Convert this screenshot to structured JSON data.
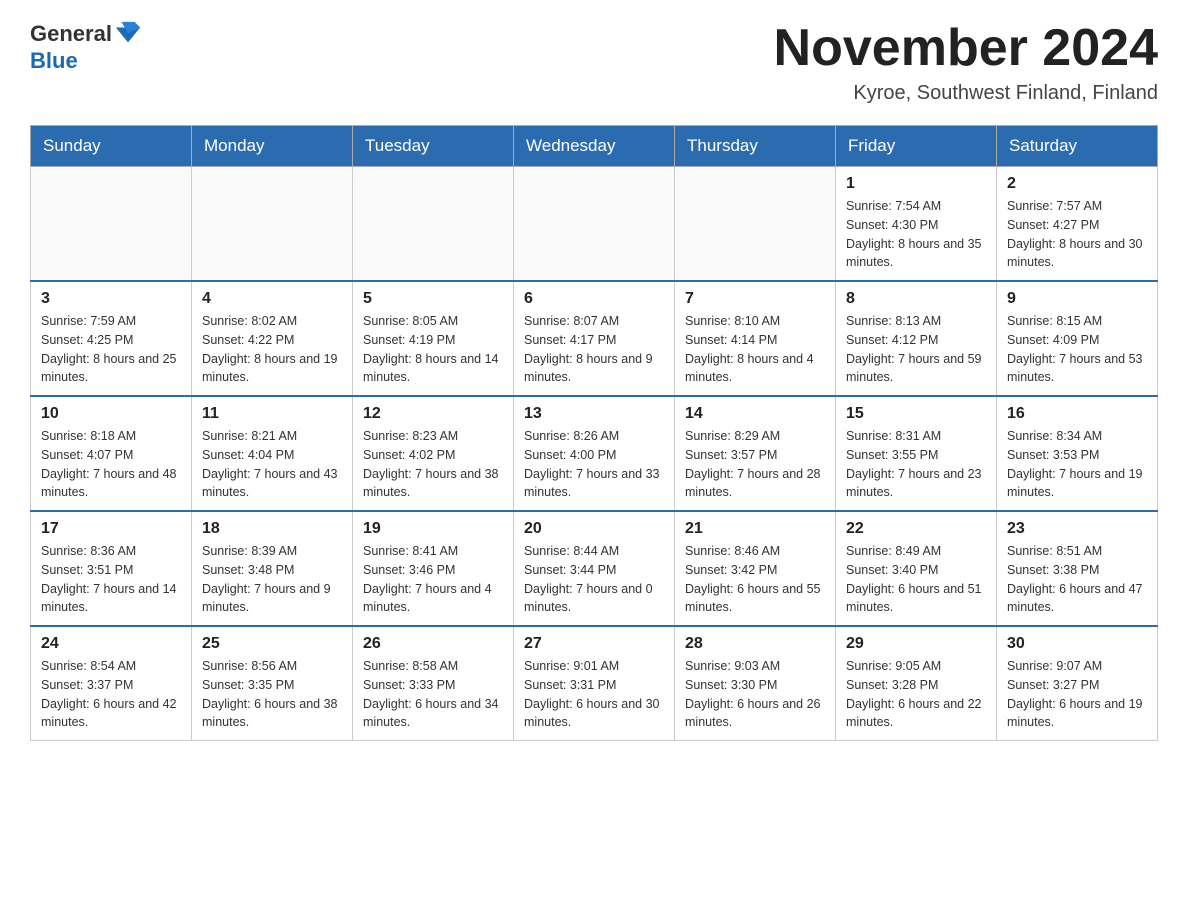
{
  "header": {
    "logo_general": "General",
    "logo_blue": "Blue",
    "month_title": "November 2024",
    "location": "Kyroe, Southwest Finland, Finland"
  },
  "weekdays": [
    "Sunday",
    "Monday",
    "Tuesday",
    "Wednesday",
    "Thursday",
    "Friday",
    "Saturday"
  ],
  "weeks": [
    [
      {
        "day": "",
        "info": ""
      },
      {
        "day": "",
        "info": ""
      },
      {
        "day": "",
        "info": ""
      },
      {
        "day": "",
        "info": ""
      },
      {
        "day": "",
        "info": ""
      },
      {
        "day": "1",
        "info": "Sunrise: 7:54 AM\nSunset: 4:30 PM\nDaylight: 8 hours and 35 minutes."
      },
      {
        "day": "2",
        "info": "Sunrise: 7:57 AM\nSunset: 4:27 PM\nDaylight: 8 hours and 30 minutes."
      }
    ],
    [
      {
        "day": "3",
        "info": "Sunrise: 7:59 AM\nSunset: 4:25 PM\nDaylight: 8 hours and 25 minutes."
      },
      {
        "day": "4",
        "info": "Sunrise: 8:02 AM\nSunset: 4:22 PM\nDaylight: 8 hours and 19 minutes."
      },
      {
        "day": "5",
        "info": "Sunrise: 8:05 AM\nSunset: 4:19 PM\nDaylight: 8 hours and 14 minutes."
      },
      {
        "day": "6",
        "info": "Sunrise: 8:07 AM\nSunset: 4:17 PM\nDaylight: 8 hours and 9 minutes."
      },
      {
        "day": "7",
        "info": "Sunrise: 8:10 AM\nSunset: 4:14 PM\nDaylight: 8 hours and 4 minutes."
      },
      {
        "day": "8",
        "info": "Sunrise: 8:13 AM\nSunset: 4:12 PM\nDaylight: 7 hours and 59 minutes."
      },
      {
        "day": "9",
        "info": "Sunrise: 8:15 AM\nSunset: 4:09 PM\nDaylight: 7 hours and 53 minutes."
      }
    ],
    [
      {
        "day": "10",
        "info": "Sunrise: 8:18 AM\nSunset: 4:07 PM\nDaylight: 7 hours and 48 minutes."
      },
      {
        "day": "11",
        "info": "Sunrise: 8:21 AM\nSunset: 4:04 PM\nDaylight: 7 hours and 43 minutes."
      },
      {
        "day": "12",
        "info": "Sunrise: 8:23 AM\nSunset: 4:02 PM\nDaylight: 7 hours and 38 minutes."
      },
      {
        "day": "13",
        "info": "Sunrise: 8:26 AM\nSunset: 4:00 PM\nDaylight: 7 hours and 33 minutes."
      },
      {
        "day": "14",
        "info": "Sunrise: 8:29 AM\nSunset: 3:57 PM\nDaylight: 7 hours and 28 minutes."
      },
      {
        "day": "15",
        "info": "Sunrise: 8:31 AM\nSunset: 3:55 PM\nDaylight: 7 hours and 23 minutes."
      },
      {
        "day": "16",
        "info": "Sunrise: 8:34 AM\nSunset: 3:53 PM\nDaylight: 7 hours and 19 minutes."
      }
    ],
    [
      {
        "day": "17",
        "info": "Sunrise: 8:36 AM\nSunset: 3:51 PM\nDaylight: 7 hours and 14 minutes."
      },
      {
        "day": "18",
        "info": "Sunrise: 8:39 AM\nSunset: 3:48 PM\nDaylight: 7 hours and 9 minutes."
      },
      {
        "day": "19",
        "info": "Sunrise: 8:41 AM\nSunset: 3:46 PM\nDaylight: 7 hours and 4 minutes."
      },
      {
        "day": "20",
        "info": "Sunrise: 8:44 AM\nSunset: 3:44 PM\nDaylight: 7 hours and 0 minutes."
      },
      {
        "day": "21",
        "info": "Sunrise: 8:46 AM\nSunset: 3:42 PM\nDaylight: 6 hours and 55 minutes."
      },
      {
        "day": "22",
        "info": "Sunrise: 8:49 AM\nSunset: 3:40 PM\nDaylight: 6 hours and 51 minutes."
      },
      {
        "day": "23",
        "info": "Sunrise: 8:51 AM\nSunset: 3:38 PM\nDaylight: 6 hours and 47 minutes."
      }
    ],
    [
      {
        "day": "24",
        "info": "Sunrise: 8:54 AM\nSunset: 3:37 PM\nDaylight: 6 hours and 42 minutes."
      },
      {
        "day": "25",
        "info": "Sunrise: 8:56 AM\nSunset: 3:35 PM\nDaylight: 6 hours and 38 minutes."
      },
      {
        "day": "26",
        "info": "Sunrise: 8:58 AM\nSunset: 3:33 PM\nDaylight: 6 hours and 34 minutes."
      },
      {
        "day": "27",
        "info": "Sunrise: 9:01 AM\nSunset: 3:31 PM\nDaylight: 6 hours and 30 minutes."
      },
      {
        "day": "28",
        "info": "Sunrise: 9:03 AM\nSunset: 3:30 PM\nDaylight: 6 hours and 26 minutes."
      },
      {
        "day": "29",
        "info": "Sunrise: 9:05 AM\nSunset: 3:28 PM\nDaylight: 6 hours and 22 minutes."
      },
      {
        "day": "30",
        "info": "Sunrise: 9:07 AM\nSunset: 3:27 PM\nDaylight: 6 hours and 19 minutes."
      }
    ]
  ]
}
